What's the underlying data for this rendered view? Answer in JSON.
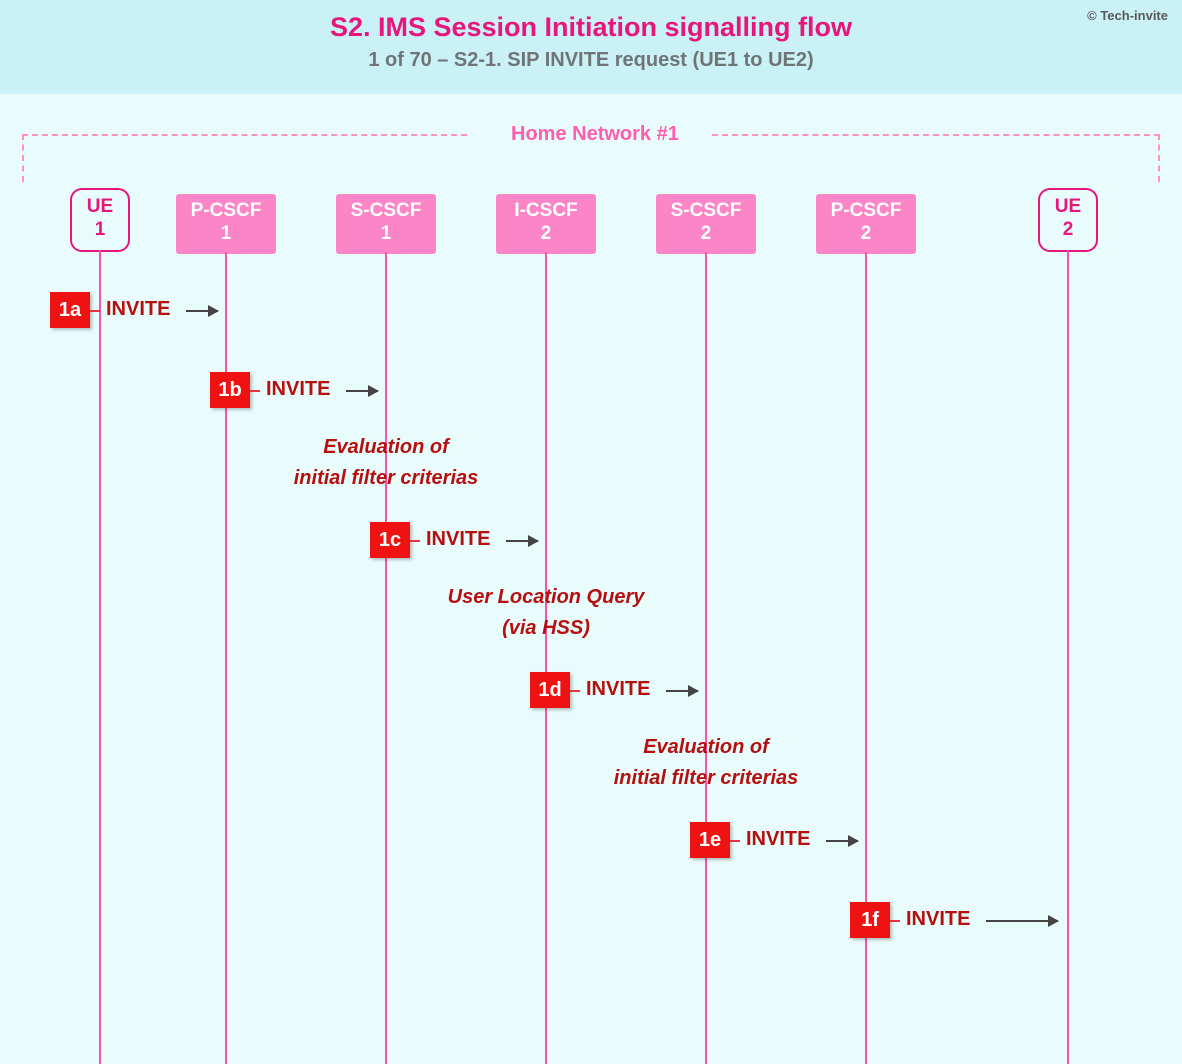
{
  "header": {
    "title": "S2. IMS Session Initiation signalling flow",
    "subtitle": "1 of 70 – S2-1. SIP INVITE request (UE1 to UE2)",
    "copyright": "© Tech-invite"
  },
  "bracket_label": "Home Network #1",
  "actors": {
    "ue1": {
      "line1": "UE",
      "line2": "1"
    },
    "pcscf1": {
      "line1": "P-CSCF",
      "line2": "1"
    },
    "scscf1": {
      "line1": "S-CSCF",
      "line2": "1"
    },
    "icscf2": {
      "line1": "I-CSCF",
      "line2": "2"
    },
    "scscf2": {
      "line1": "S-CSCF",
      "line2": "2"
    },
    "pcscf2": {
      "line1": "P-CSCF",
      "line2": "2"
    },
    "ue2": {
      "line1": "UE",
      "line2": "2"
    }
  },
  "steps": {
    "a": {
      "id": "1a",
      "msg": "INVITE"
    },
    "b": {
      "id": "1b",
      "msg": "INVITE"
    },
    "c": {
      "id": "1c",
      "msg": "INVITE"
    },
    "d": {
      "id": "1d",
      "msg": "INVITE"
    },
    "e": {
      "id": "1e",
      "msg": "INVITE"
    },
    "f": {
      "id": "1f",
      "msg": "INVITE"
    }
  },
  "notes": {
    "n1": "Evaluation of\ninitial filter criterias",
    "n2": "User Location Query\n(via HSS)",
    "n3": "Evaluation of\ninitial filter criterias"
  },
  "chart_data": {
    "type": "sequence-diagram",
    "title": "S2. IMS Session Initiation signalling flow",
    "subtitle": "1 of 70 – S2-1. SIP INVITE request (UE1 to UE2)",
    "group": {
      "label": "Home Network #1",
      "members": [
        "UE 1",
        "P-CSCF 1",
        "S-CSCF 1",
        "I-CSCF 2",
        "S-CSCF 2",
        "P-CSCF 2",
        "UE 2"
      ]
    },
    "participants": [
      "UE 1",
      "P-CSCF 1",
      "S-CSCF 1",
      "I-CSCF 2",
      "S-CSCF 2",
      "P-CSCF 2",
      "UE 2"
    ],
    "events": [
      {
        "id": "1a",
        "from": "UE 1",
        "to": "P-CSCF 1",
        "label": "INVITE"
      },
      {
        "id": "1b",
        "from": "P-CSCF 1",
        "to": "S-CSCF 1",
        "label": "INVITE"
      },
      {
        "note": "Evaluation of initial filter criterias",
        "at": "S-CSCF 1"
      },
      {
        "id": "1c",
        "from": "S-CSCF 1",
        "to": "I-CSCF 2",
        "label": "INVITE"
      },
      {
        "note": "User Location Query (via HSS)",
        "at": "I-CSCF 2"
      },
      {
        "id": "1d",
        "from": "I-CSCF 2",
        "to": "S-CSCF 2",
        "label": "INVITE"
      },
      {
        "note": "Evaluation of initial filter criterias",
        "at": "S-CSCF 2"
      },
      {
        "id": "1e",
        "from": "S-CSCF 2",
        "to": "P-CSCF 2",
        "label": "INVITE"
      },
      {
        "id": "1f",
        "from": "P-CSCF 2",
        "to": "UE 2",
        "label": "INVITE"
      }
    ]
  }
}
